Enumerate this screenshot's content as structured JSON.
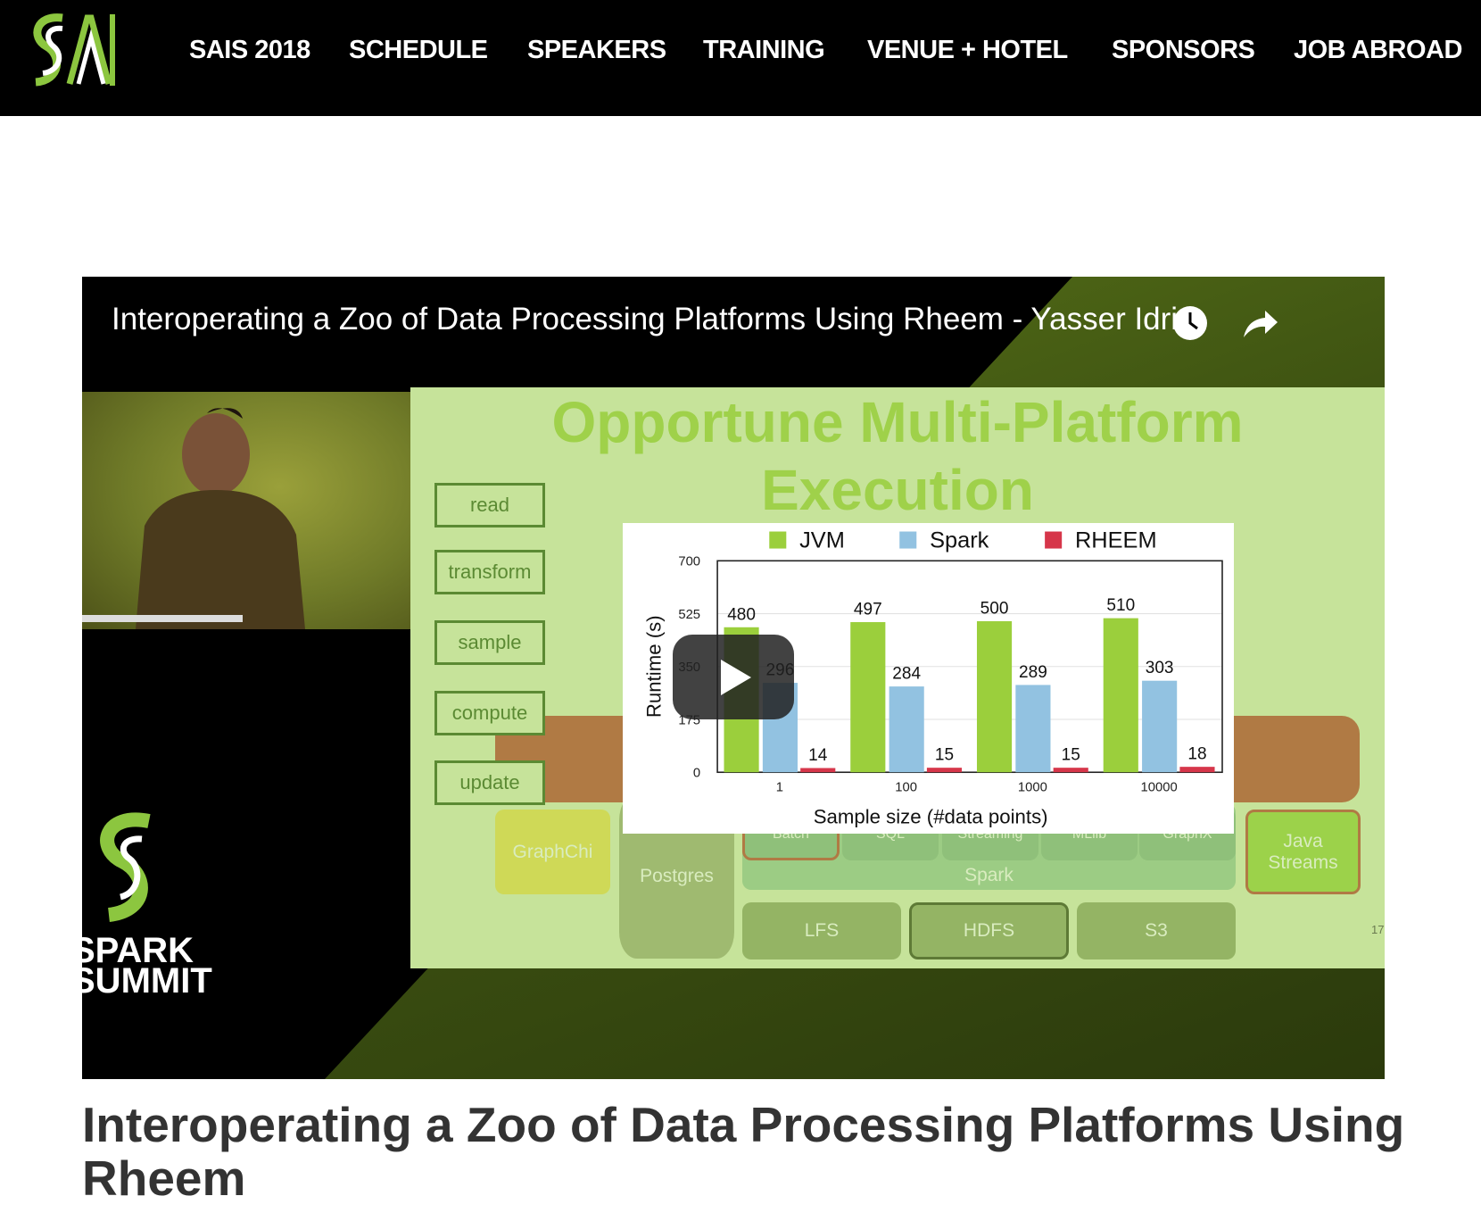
{
  "nav": {
    "items": [
      "SAIS 2018",
      "SCHEDULE",
      "SPEAKERS",
      "TRAINING",
      "VENUE + HOTEL",
      "SPONSORS",
      "JOB ABROAD"
    ]
  },
  "video": {
    "title": "Interoperating a Zoo of Data Processing Platforms Using Rheem - Yasser Idri...",
    "icons": [
      "clock-icon",
      "share-icon",
      "play-icon"
    ],
    "slide": {
      "title1": "Opportune Multi-Platform",
      "title2": "Execution",
      "flow": [
        "read",
        "transform",
        "sample",
        "compute",
        "update"
      ],
      "blocks": {
        "graphchi": "GraphChi",
        "postgres": "Postgres",
        "batch": "Batch",
        "sql": "SQL",
        "streaming": "Streaming",
        "mllib": "MLlib",
        "graphx": "GraphX",
        "spark": "Spark",
        "java": "Java Streams",
        "lfs": "LFS",
        "hdfs": "HDFS",
        "s3": "S3"
      },
      "page_number": "17",
      "chart": {
        "legend": [
          "JVM",
          "Spark",
          "RHEEM"
        ],
        "colors": [
          "#9bcf3c",
          "#92c2e1",
          "#d6364a"
        ],
        "categories": [
          "1",
          "100",
          "1000",
          "10000"
        ],
        "yticks": [
          "0",
          "175",
          "350",
          "525",
          "700"
        ],
        "ylabel": "Runtime (s)",
        "xlabel": "Sample size (#data points)",
        "ymax": 700,
        "series": [
          [
            480,
            497,
            500,
            510
          ],
          [
            296,
            284,
            289,
            303
          ],
          [
            14,
            15,
            15,
            18
          ]
        ]
      }
    },
    "watermark": {
      "line1": "SPARK",
      "line2": "SUMMIT"
    }
  },
  "page": {
    "title": "Interoperating a Zoo of Data Processing Platforms Using Rheem"
  }
}
